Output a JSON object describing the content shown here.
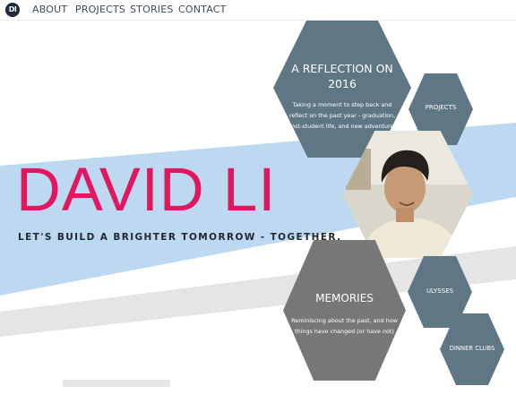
{
  "nav": {
    "logo_text": "Dl",
    "items": [
      "ABOUT",
      "PROJECTS",
      "STORIES",
      "CONTACT"
    ]
  },
  "hero": {
    "title": "DAVID LI",
    "subtitle": "LET'S BUILD A BRIGHTER TOMORROW - TOGETHER."
  },
  "tiles": {
    "reflection": {
      "title_line1": "A REFLECTION ON",
      "title_line2": "2016",
      "desc_line1": "Taking a moment to step back and",
      "desc_line2": "reflect on the past year - graduation,",
      "desc_line3": "post-student life, and new adventures"
    },
    "projects": {
      "label": "PROJECTS"
    },
    "memories": {
      "title": "MEMORIES",
      "desc_line1": "Reminiscing about the past, and how",
      "desc_line2": "things have changed (or have not)"
    },
    "ulysses": {
      "label": "ULYSSES"
    },
    "dinner": {
      "label": "DINNER CLUBS"
    }
  },
  "colors": {
    "accent": "#e0185f",
    "tile_slate": "#5f7785",
    "tile_gray": "#777777",
    "band_blue": "#bcd9f1",
    "band_gray": "#e5e5e5",
    "title_dark": "#222831"
  }
}
